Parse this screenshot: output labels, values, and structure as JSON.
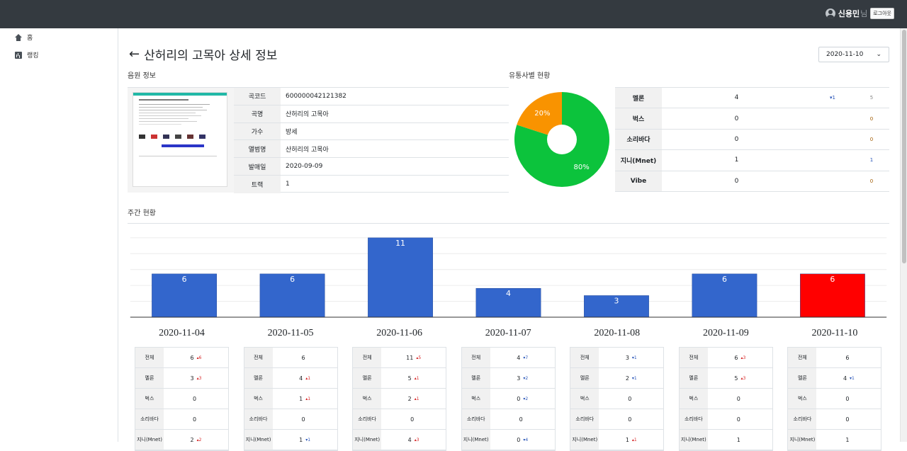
{
  "user": {
    "name": "신용민",
    "suffix": "님",
    "logout_label": "로그아웃"
  },
  "sidebar": {
    "items": [
      {
        "label": "홈",
        "icon": "home-icon"
      },
      {
        "label": "랭킹",
        "icon": "chart-icon"
      }
    ]
  },
  "page": {
    "title": "산허리의 고목아 상세 정보",
    "selected_date": "2020-11-10"
  },
  "sections": {
    "info": "음원 정보",
    "distribution": "유통사별 현황",
    "weekly": "주간 현황"
  },
  "song_info": [
    {
      "label": "곡코드",
      "value": "600000042121382"
    },
    {
      "label": "곡명",
      "value": "산허리의 고목아"
    },
    {
      "label": "가수",
      "value": "방세"
    },
    {
      "label": "앨범명",
      "value": "산허리의 고목아"
    },
    {
      "label": "발매일",
      "value": "2020-09-09"
    },
    {
      "label": "트랙",
      "value": "1"
    }
  ],
  "pie": {
    "slices": [
      {
        "label": "80%",
        "value": 80,
        "color": "#0cc33c"
      },
      {
        "label": "20%",
        "value": 20,
        "color": "#f99300"
      }
    ]
  },
  "distributors": [
    {
      "name": "멜론",
      "value": "4",
      "change": "▾1",
      "prev": "5"
    },
    {
      "name": "벅스",
      "value": "0",
      "change": "",
      "prev": "0"
    },
    {
      "name": "소리바다",
      "value": "0",
      "change": "",
      "prev": "0"
    },
    {
      "name": "지니(Mnet)",
      "value": "1",
      "change": "",
      "prev": "1"
    },
    {
      "name": "Vibe",
      "value": "0",
      "change": "",
      "prev": "0"
    }
  ],
  "chart_data": {
    "type": "bar",
    "categories": [
      "2020-11-04",
      "2020-11-05",
      "2020-11-06",
      "2020-11-07",
      "2020-11-08",
      "2020-11-09",
      "2020-11-10"
    ],
    "values": [
      6,
      6,
      11,
      4,
      3,
      6,
      6
    ],
    "colors": [
      "#3366cc",
      "#3366cc",
      "#3366cc",
      "#3366cc",
      "#3366cc",
      "#3366cc",
      "#ff0000"
    ],
    "title": "",
    "xlabel": "",
    "ylabel": "",
    "ylim": [
      0,
      11
    ]
  },
  "weekly": [
    {
      "date": "2020-11-04",
      "rows": [
        {
          "label": "전체",
          "value": "6",
          "chg": "▴6",
          "dir": "up"
        },
        {
          "label": "멜론",
          "value": "3",
          "chg": "▴3",
          "dir": "up"
        },
        {
          "label": "벅스",
          "value": "0",
          "chg": "",
          "dir": ""
        },
        {
          "label": "소리바다",
          "value": "0",
          "chg": "",
          "dir": ""
        },
        {
          "label": "지니(Mnet)",
          "value": "2",
          "chg": "▴2",
          "dir": "up"
        }
      ]
    },
    {
      "date": "2020-11-05",
      "rows": [
        {
          "label": "전체",
          "value": "6",
          "chg": "",
          "dir": ""
        },
        {
          "label": "멜론",
          "value": "4",
          "chg": "▴1",
          "dir": "up"
        },
        {
          "label": "벅스",
          "value": "1",
          "chg": "▴1",
          "dir": "up"
        },
        {
          "label": "소리바다",
          "value": "0",
          "chg": "",
          "dir": ""
        },
        {
          "label": "지니(Mnet)",
          "value": "1",
          "chg": "▾1",
          "dir": "down"
        }
      ]
    },
    {
      "date": "2020-11-06",
      "rows": [
        {
          "label": "전체",
          "value": "11",
          "chg": "▴5",
          "dir": "up"
        },
        {
          "label": "멜론",
          "value": "5",
          "chg": "▴1",
          "dir": "up"
        },
        {
          "label": "벅스",
          "value": "2",
          "chg": "▴1",
          "dir": "up"
        },
        {
          "label": "소리바다",
          "value": "0",
          "chg": "",
          "dir": ""
        },
        {
          "label": "지니(Mnet)",
          "value": "4",
          "chg": "▴3",
          "dir": "up"
        }
      ]
    },
    {
      "date": "2020-11-07",
      "rows": [
        {
          "label": "전체",
          "value": "4",
          "chg": "▾7",
          "dir": "down"
        },
        {
          "label": "멜론",
          "value": "3",
          "chg": "▾2",
          "dir": "down"
        },
        {
          "label": "벅스",
          "value": "0",
          "chg": "▾2",
          "dir": "down"
        },
        {
          "label": "소리바다",
          "value": "0",
          "chg": "",
          "dir": ""
        },
        {
          "label": "지니(Mnet)",
          "value": "0",
          "chg": "▾4",
          "dir": "down"
        }
      ]
    },
    {
      "date": "2020-11-08",
      "rows": [
        {
          "label": "전체",
          "value": "3",
          "chg": "▾1",
          "dir": "down"
        },
        {
          "label": "멜론",
          "value": "2",
          "chg": "▾1",
          "dir": "down"
        },
        {
          "label": "벅스",
          "value": "0",
          "chg": "",
          "dir": ""
        },
        {
          "label": "소리바다",
          "value": "0",
          "chg": "",
          "dir": ""
        },
        {
          "label": "지니(Mnet)",
          "value": "1",
          "chg": "▴1",
          "dir": "up"
        }
      ]
    },
    {
      "date": "2020-11-09",
      "rows": [
        {
          "label": "전체",
          "value": "6",
          "chg": "▴3",
          "dir": "up"
        },
        {
          "label": "멜론",
          "value": "5",
          "chg": "▴3",
          "dir": "up"
        },
        {
          "label": "벅스",
          "value": "0",
          "chg": "",
          "dir": ""
        },
        {
          "label": "소리바다",
          "value": "0",
          "chg": "",
          "dir": ""
        },
        {
          "label": "지니(Mnet)",
          "value": "1",
          "chg": "",
          "dir": ""
        }
      ]
    },
    {
      "date": "2020-11-10",
      "rows": [
        {
          "label": "전체",
          "value": "6",
          "chg": "",
          "dir": ""
        },
        {
          "label": "멜론",
          "value": "4",
          "chg": "▾1",
          "dir": "down"
        },
        {
          "label": "벅스",
          "value": "0",
          "chg": "",
          "dir": ""
        },
        {
          "label": "소리바다",
          "value": "0",
          "chg": "",
          "dir": ""
        },
        {
          "label": "지니(Mnet)",
          "value": "1",
          "chg": "",
          "dir": ""
        }
      ]
    }
  ]
}
